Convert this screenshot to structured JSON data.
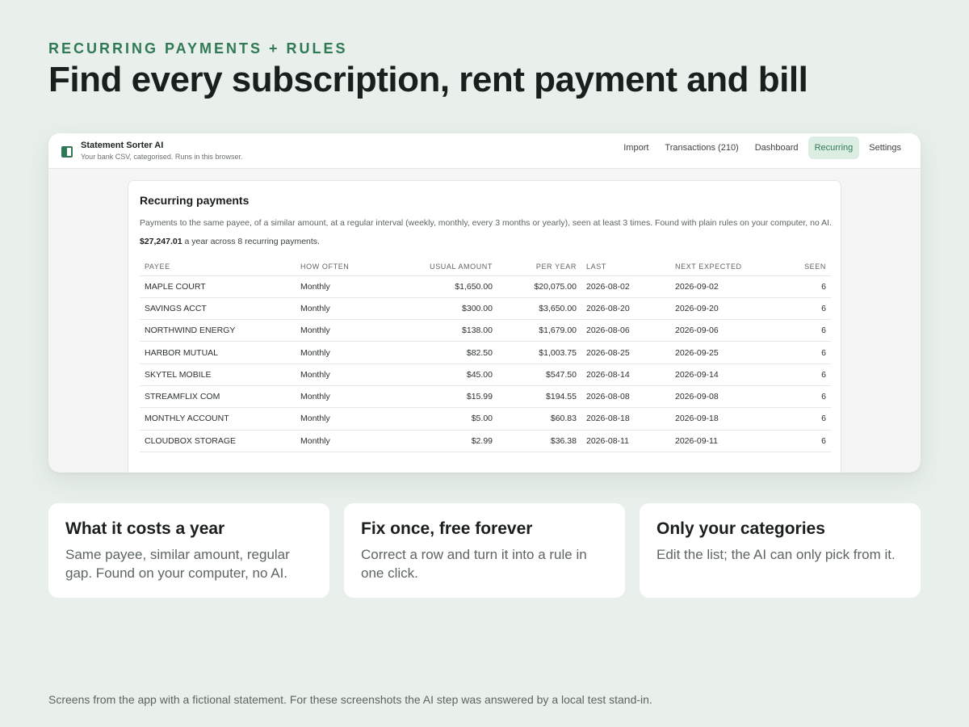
{
  "eyebrow": "RECURRING PAYMENTS + RULES",
  "headline": "Find every subscription, rent payment and bill",
  "app": {
    "name": "Statement Sorter AI",
    "subtitle": "Your bank CSV, categorised. Runs in this browser.",
    "nav": [
      {
        "label": "Import"
      },
      {
        "label": "Transactions (210)"
      },
      {
        "label": "Dashboard"
      },
      {
        "label": "Recurring",
        "active": true
      },
      {
        "label": "Settings"
      }
    ]
  },
  "recurring": {
    "title": "Recurring payments",
    "description": "Payments to the same payee, of a similar amount, at a regular interval (weekly, monthly, every 3 months or yearly), seen at least 3 times. Found with plain rules on your computer, no AI.",
    "total": "$27,247.01",
    "total_suffix": "a year across 8 recurring payments.",
    "columns": [
      "PAYEE",
      "HOW OFTEN",
      "USUAL AMOUNT",
      "PER YEAR",
      "LAST",
      "NEXT EXPECTED",
      "SEEN"
    ],
    "rows": [
      [
        "MAPLE COURT",
        "Monthly",
        "$1,650.00",
        "$20,075.00",
        "2026-08-02",
        "2026-09-02",
        "6"
      ],
      [
        "SAVINGS ACCT",
        "Monthly",
        "$300.00",
        "$3,650.00",
        "2026-08-20",
        "2026-09-20",
        "6"
      ],
      [
        "NORTHWIND ENERGY",
        "Monthly",
        "$138.00",
        "$1,679.00",
        "2026-08-06",
        "2026-09-06",
        "6"
      ],
      [
        "HARBOR MUTUAL",
        "Monthly",
        "$82.50",
        "$1,003.75",
        "2026-08-25",
        "2026-09-25",
        "6"
      ],
      [
        "SKYTEL MOBILE",
        "Monthly",
        "$45.00",
        "$547.50",
        "2026-08-14",
        "2026-09-14",
        "6"
      ],
      [
        "STREAMFLIX COM",
        "Monthly",
        "$15.99",
        "$194.55",
        "2026-08-08",
        "2026-09-08",
        "6"
      ],
      [
        "MONTHLY ACCOUNT",
        "Monthly",
        "$5.00",
        "$60.83",
        "2026-08-18",
        "2026-09-18",
        "6"
      ],
      [
        "CLOUDBOX STORAGE",
        "Monthly",
        "$2.99",
        "$36.38",
        "2026-08-11",
        "2026-09-11",
        "6"
      ]
    ]
  },
  "features": [
    {
      "title": "What it costs a year",
      "body": "Same payee, similar amount, regular gap. Found on your computer, no AI."
    },
    {
      "title": "Fix once, free forever",
      "body": "Correct a row and turn it into a rule in one click."
    },
    {
      "title": "Only your categories",
      "body": "Edit the list; the AI can only pick from it."
    }
  ],
  "footnote": "Screens from the app with a fictional statement. For these screenshots the AI step was answered by a local test stand-in.",
  "colors": {
    "accent": "#2f7a55",
    "background": "#e9f0eb",
    "active_tab_bg": "#dcede3"
  }
}
